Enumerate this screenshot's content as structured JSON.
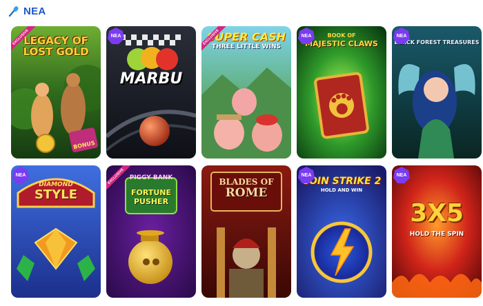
{
  "section": {
    "title": "NEA",
    "icon": "microphone-icon"
  },
  "labels": {
    "new": "NEA",
    "exclusive": "EXCLUSIVE"
  },
  "games": [
    {
      "line1": "LEGACY OF",
      "line2": "LOST GOLD",
      "extra": "BONUS",
      "badge": "exclusive"
    },
    {
      "line1": "MARBU",
      "line2": "",
      "extra": "",
      "badge": "new"
    },
    {
      "line1": "SUPER CASH",
      "line2": "THREE LITTLE WINS",
      "extra": "",
      "badge": "exclusive"
    },
    {
      "line1": "BOOK OF",
      "line2": "MAJESTIC CLAWS",
      "extra": "",
      "badge": "new"
    },
    {
      "line1": "BLACK FOREST TREASURES",
      "line2": "",
      "extra": "",
      "badge": "new"
    },
    {
      "line1": "DIAMOND",
      "line2": "STYLE",
      "extra": "",
      "badge": "new"
    },
    {
      "line1": "PIGGY BANK",
      "line2": "FORTUNE PUSHER",
      "extra": "",
      "badge": "exclusive"
    },
    {
      "line1": "BLADES OF",
      "line2": "ROME",
      "extra": "",
      "badge": "none"
    },
    {
      "line1": "COIN STRIKE 2",
      "line2": "HOLD AND WIN",
      "extra": "",
      "badge": "new"
    },
    {
      "line1": "3X5",
      "line2": "HOLD THE SPIN",
      "extra": "",
      "badge": "new"
    }
  ],
  "colors": {
    "accent": "#1e56c8",
    "new_badge": "#7a3cf0",
    "exclusive_ribbon": "#d32680"
  }
}
